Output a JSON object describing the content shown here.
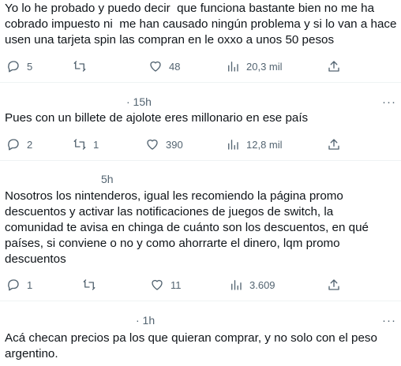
{
  "posts": [
    {
      "time": "",
      "text": "Yo lo he probado y puedo decir  que funciona bastante bien no me ha\ncobrado impuesto ni  me han causado ningún problema y si lo van a hace\nusen una tarjeta spin las compran en le oxxo a unos 50 pesos",
      "replies": "5",
      "retweets": "",
      "likes": "48",
      "views": "20,3 mil"
    },
    {
      "time": "· 15h",
      "text": "Pues con un billete de ajolote eres millonario en ese país",
      "replies": "2",
      "retweets": "1",
      "likes": "390",
      "views": "12,8 mil"
    },
    {
      "time": "5h",
      "text": "Nosotros los nintenderos, igual les recomiendo la página promo\ndescuentos y activar las notificaciones de juegos de switch, la\ncomunidad te avisa en chinga de cuánto son los descuentos, en qué\npaíses, si conviene o no y como ahorrarte el dinero, lqm promo\ndescuentos",
      "replies": "1",
      "retweets": "",
      "likes": "11",
      "views": "3.609"
    },
    {
      "time": "· 1h",
      "text": "Acá checan precios pa los que quieran comprar, y no solo con el peso\nargentino.",
      "replies": "",
      "retweets": "",
      "likes": "",
      "views": ""
    }
  ],
  "more_icon": "···",
  "icons": [
    "reply-icon",
    "retweet-icon",
    "like-icon",
    "views-icon",
    "share-icon"
  ],
  "colors": {
    "muted": "#536471",
    "text": "#0f1419",
    "divider": "#eff3f4"
  }
}
